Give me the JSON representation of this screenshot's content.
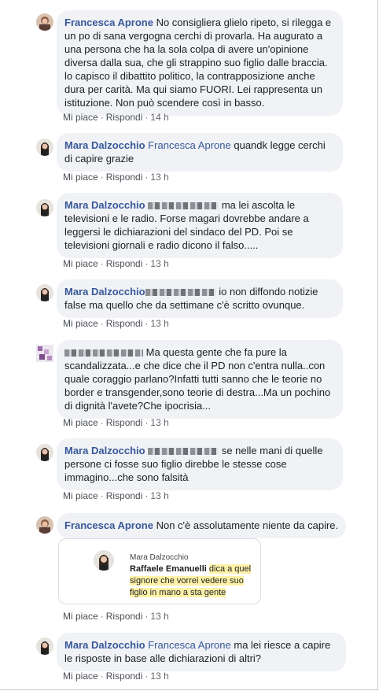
{
  "comments": [
    {
      "author": "Francesca Aprone",
      "text": "No consigliera glielo ripeto, si rilegga e un po di sana vergogna cerchi di provarla. Ha augurato a una persona che ha la sola colpa di avere un'opinione diversa dalla sua, che gli strappino suo figlio dalle braccia. lo capisco il dibattito politico, la contrapposizione anche dura per carità. Ma qui siamo FUORI. Lei rappresenta un istituzione. Non può scendere così in basso.",
      "like": "Mi piace",
      "reply": "Rispondi",
      "time": "14 h"
    },
    {
      "author": "Mara Dalzocchio",
      "mention": "Francesca Aprone",
      "text": "quandk legge cerchi di capire grazie",
      "like": "Mi piace",
      "reply": "Rispondi",
      "time": "13 h"
    },
    {
      "author": "Mara Dalzocchio",
      "text": "ma lei ascolta le televisioni e le radio. Forse magari dovrebbe andare a leggersi le dichiarazioni del sindaco del PD. Poi se televisioni giornali e radio dicono il falso.....",
      "like": "Mi piace",
      "reply": "Rispondi",
      "time": "13 h"
    },
    {
      "author": "Mara Dalzocchio",
      "text": "io non diffondo notizie false ma quello che da settimane c'è scritto ovunque.",
      "like": "Mi piace",
      "reply": "Rispondi",
      "time": "13 h"
    },
    {
      "text": "Ma questa gente che fa pure la scandalizzata...e che dice che il PD non c'entra nulla..con quale coraggio parlano?Infatti tutti sanno che le teorie no border e transgender,sono teorie di destra...Ma un pochino di dignità l'avete?Che ipocrisia...",
      "like": "Mi piace",
      "reply": "Rispondi",
      "time": "13 h"
    },
    {
      "author": "Mara Dalzocchio",
      "text": "se nelle mani di quelle persone ci fosse suo figlio direbbe le stesse cose immagino...che sono falsità",
      "like": "Mi piace",
      "reply": "Rispondi",
      "time": "13 h"
    },
    {
      "author": "Francesca Aprone",
      "text": "Non c'è assolutamente niente da capire.",
      "like": "Mi piace",
      "reply": "Rispondi",
      "time": "13 h"
    },
    {
      "author": "Mara Dalzocchio",
      "mention": "Francesca Aprone",
      "text": "ma lei riesce a capire le risposte in base alle dichiarazioni di altri?",
      "like": "Mi piace",
      "reply": "Rispondi",
      "time": "13 h"
    }
  ],
  "quote": {
    "author": "Mara Dalzocchio",
    "mention": "Raffaele Emanuelli",
    "text": "dica a quel signore che vorrei vedere suo figlio in mano a sta gente"
  },
  "colors": {
    "link": "#385898",
    "bubble": "#f0f2f5",
    "meta": "#65676b",
    "highlight": "#fff2a8"
  }
}
